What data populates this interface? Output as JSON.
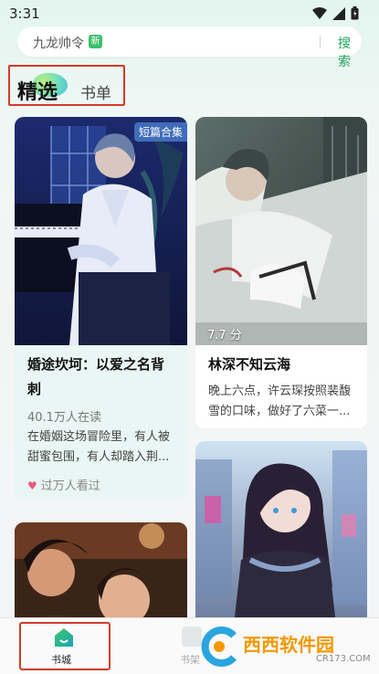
{
  "status": {
    "time": "3:31"
  },
  "search": {
    "placeholder_text": "九龙帅令",
    "badge": "新",
    "button": "搜索"
  },
  "tabs": [
    {
      "label": "精选",
      "active": true
    },
    {
      "label": "书单",
      "active": false
    }
  ],
  "cards": [
    {
      "tag": "短篇合集",
      "title": "婚途坎坷：以爱之名背",
      "title_line2": "刺",
      "readers": "40.1万人在读",
      "desc_line1": "在婚姻这场冒险里，有人被",
      "desc_line2": "甜蜜包围，有人却踏入荆...",
      "meta": "过万人看过"
    },
    {
      "rating": "7.7 分",
      "title": "林深不知云海",
      "desc_line1": "晚上六点，许云琛按照裴馥",
      "desc_line2": "雪的口味，做好了六菜一..."
    }
  ],
  "bottom_nav": [
    {
      "label": "书城",
      "active": true,
      "icon": "home-icon"
    },
    {
      "label": "书架",
      "active": false,
      "icon": "bookshelf-icon"
    }
  ],
  "watermark": {
    "text": "西西软件园",
    "url": "CR173.COM"
  },
  "colors": {
    "accent": "#21a45a",
    "highlight_box": "#d23a2a"
  }
}
